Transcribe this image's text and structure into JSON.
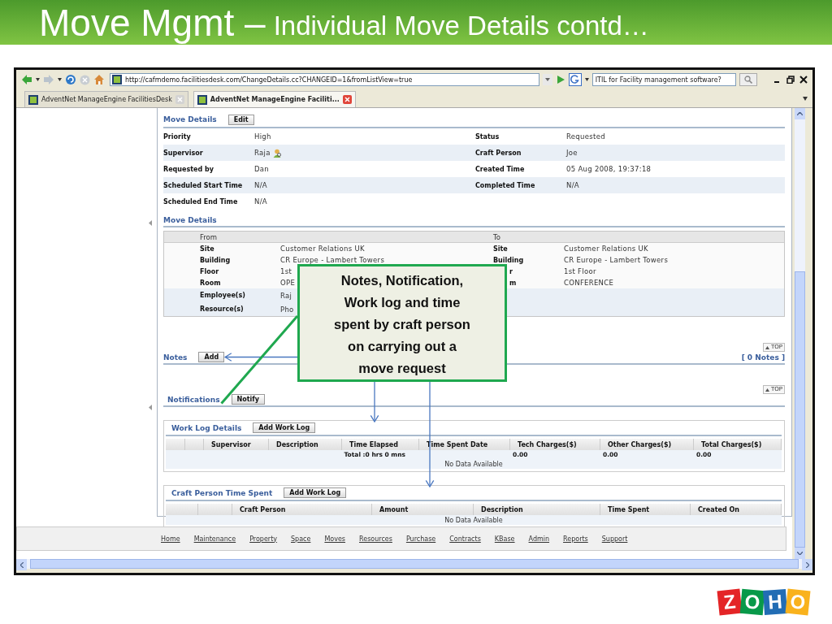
{
  "slide": {
    "title": "Move Mgmt –",
    "subtitle": "Individual Move Details contd…"
  },
  "browser": {
    "url": "http://cafmdemo.facilitiesdesk.com/ChangeDetails.cc?CHANGEID=1&fromListView=true",
    "search": {
      "value": "ITIL for Facility management software?"
    },
    "tabs": [
      {
        "label": "AdventNet ManageEngine FacilitiesDesk",
        "selected": false
      },
      {
        "label": "AdventNet ManageEngine Faciliti...",
        "selected": true
      }
    ]
  },
  "move_details": {
    "title": "Move Details",
    "button": "Edit",
    "rows": [
      {
        "left": {
          "label": "Priority",
          "value": "High",
          "kind": "text"
        },
        "right": {
          "label": "Status",
          "value": "Requested",
          "kind": "text"
        }
      },
      {
        "left": {
          "label": "Supervisor",
          "value": "Raja",
          "kind": "person"
        },
        "right": {
          "label": "Craft Person",
          "value": "Joe",
          "kind": "text"
        }
      },
      {
        "left": {
          "label": "Requested by",
          "value": "Dan",
          "kind": "text"
        },
        "right": {
          "label": "Created Time",
          "value": "05 Aug 2008, 19:37:18",
          "kind": "text"
        }
      },
      {
        "left": {
          "label": "Scheduled Start Time",
          "value": "N/A",
          "kind": "text"
        },
        "right": {
          "label": "Completed Time",
          "value": "N/A",
          "kind": "text"
        }
      },
      {
        "left": {
          "label": "Scheduled End Time",
          "value": "N/A",
          "kind": "text"
        }
      }
    ]
  },
  "location": {
    "title": "Move Details",
    "from_heading": "From",
    "to_heading": "To",
    "rows": [
      {
        "from_label": "Site",
        "from_value": "Customer Relations UK",
        "to_label": "Site",
        "to_value": "Customer Relations UK",
        "to_label_cut": false,
        "highlighted": false
      },
      {
        "from_label": "Building",
        "from_value": "CR Europe - Lambert Towers",
        "to_label": "Building",
        "to_value": "CR Europe - Lambert Towers",
        "to_label_cut": false,
        "highlighted": false
      },
      {
        "from_label": "Floor",
        "from_value": "1st",
        "to_label": "r",
        "to_value": "1st Floor",
        "to_label_cut": true,
        "highlighted": false
      },
      {
        "from_label": "Room",
        "from_value": "OPE",
        "to_label": "m",
        "to_value": "CONFERENCE",
        "to_label_cut": true,
        "highlighted": false
      },
      {
        "from_label": "Employee(s)",
        "from_value": "Raj",
        "highlighted": true
      },
      {
        "from_label": "Resource(s)",
        "from_value": "Pho",
        "highlighted": true
      }
    ]
  },
  "notes": {
    "title": "Notes",
    "button": "Add",
    "top": "TOP",
    "count": "[ 0 Notes ]"
  },
  "notifications": {
    "title": "Notifications",
    "button": "Notify",
    "top": "TOP"
  },
  "work_log": {
    "title": "Work Log Details",
    "button": "Add Work Log",
    "columns": [
      "Supervisor",
      "Description",
      "Time Elapsed",
      "Time Spent Date",
      "Tech Charges($)",
      "Other Charges($)",
      "Total Charges($)"
    ],
    "totals": {
      "label": "Total :0 hrs 0 mns",
      "tech_charges": "0.00",
      "other_charges": "0.00",
      "total_charges": "0.00"
    },
    "empty": "No Data Available"
  },
  "craft_time": {
    "title": "Craft Person Time Spent",
    "button": "Add Work Log",
    "columns": [
      "Craft Person",
      "Amount",
      "Description",
      "Time Spent",
      "Created On"
    ],
    "empty": "No Data Available"
  },
  "footer_links": [
    "Home",
    "Maintenance",
    "Property",
    "Space",
    "Moves",
    "Resources",
    "Purchase",
    "Contracts",
    "KBase",
    "Admin",
    "Reports",
    "Support"
  ],
  "callout": {
    "text": "Notes, Notification, Work log and time spent by craft person on carrying out a move request"
  },
  "logo": {
    "letters": [
      "Z",
      "O",
      "H",
      "O"
    ]
  }
}
